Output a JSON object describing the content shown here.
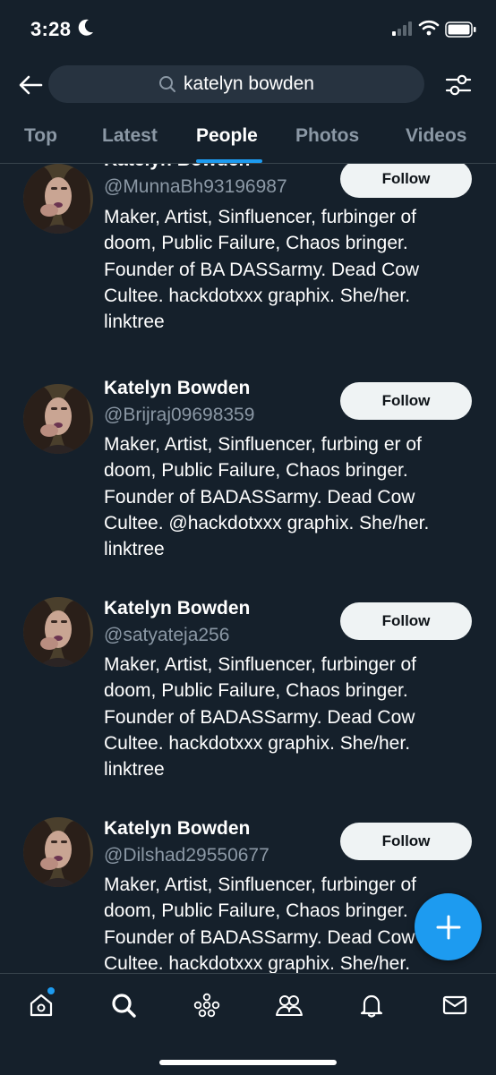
{
  "status": {
    "time": "3:28"
  },
  "search": {
    "query": "katelyn bowden"
  },
  "tabs": [
    {
      "label": "Top"
    },
    {
      "label": "Latest"
    },
    {
      "label": "People"
    },
    {
      "label": "Photos"
    },
    {
      "label": "Videos"
    }
  ],
  "active_tab": "People",
  "results": [
    {
      "name": "Katelyn Bowden",
      "handle": "@MunnaBh93196987",
      "follow_label": "Follow",
      "bio": "Maker, Artist, Sinfluencer, furbinger of doom, Public Failure, Chaos bringer. Founder of BA DASSarmy. Dead Cow Cultee. hackdotxxx graphix. She/her. linktree"
    },
    {
      "name": "Katelyn Bowden",
      "handle": "@Brijraj09698359",
      "follow_label": "Follow",
      "bio": "Maker, Artist, Sinfluencer, furbing er of doom, Public Failure, Chaos bringer. Founder of BADASSarmy. Dead Cow Cultee. @hackdotxxx graphix. She/her. linktree"
    },
    {
      "name": "Katelyn Bowden",
      "handle": "@satyateja256",
      "follow_label": "Follow",
      "bio": "Maker, Artist, Sinfluencer, furbinger of doom, Public Failure, Chaos bringer. Founder of BADASSarmy. Dead Cow Cultee. hackdotxxx graphix. She/her. linktree"
    },
    {
      "name": "Katelyn Bowden",
      "handle": "@Dilshad29550677",
      "follow_label": "Follow",
      "bio": "Maker, Artist, Sinfluencer, furbinger of doom, Public Failure, Chaos bringer. Founder of BADASSarmy. Dead Cow Cultee. hackdotxxx graphix. She/her."
    }
  ],
  "bottom_nav": [
    {
      "icon": "home-icon"
    },
    {
      "icon": "search-icon"
    },
    {
      "icon": "spaces-icon"
    },
    {
      "icon": "communities-icon"
    },
    {
      "icon": "notifications-icon"
    },
    {
      "icon": "messages-icon"
    }
  ],
  "colors": {
    "background": "#15202b",
    "accent": "#1d9bf0",
    "secondary_text": "#8b98a5",
    "button_bg": "#eff3f4",
    "divider": "#38444d"
  }
}
